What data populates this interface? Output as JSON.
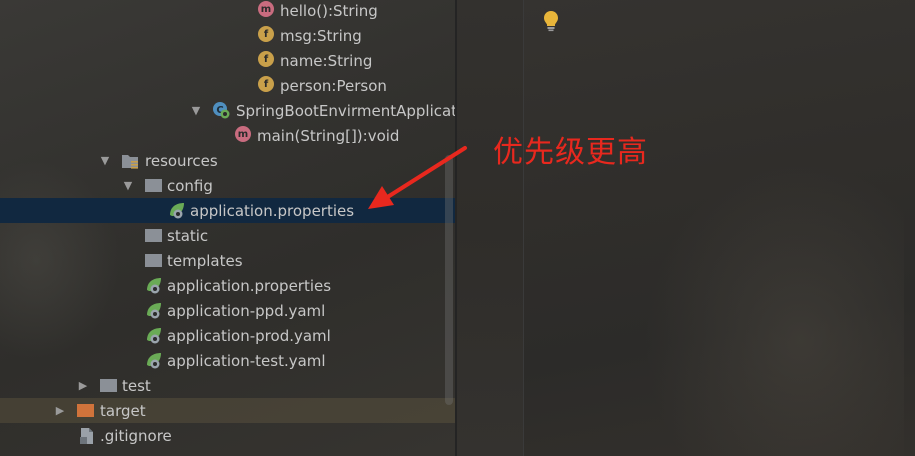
{
  "tree": {
    "items": [
      {
        "label": "hello():String",
        "icon": "method-icon",
        "icon_letter": "m"
      },
      {
        "label": "msg:String",
        "icon": "field-icon",
        "icon_letter": "f"
      },
      {
        "label": "name:String",
        "icon": "field-icon",
        "icon_letter": "f"
      },
      {
        "label": "person:Person",
        "icon": "field-icon",
        "icon_letter": "f"
      },
      {
        "label": "SpringBootEnvirmentApplicati",
        "icon": "spring-class-icon",
        "expanded": true
      },
      {
        "label": "main(String[]):void",
        "icon": "method-icon",
        "icon_letter": "m"
      },
      {
        "label": "resources",
        "icon": "resources-folder-icon",
        "expanded": true
      },
      {
        "label": "config",
        "icon": "folder-icon",
        "expanded": true
      },
      {
        "label": "application.properties",
        "icon": "spring-properties-icon",
        "selected": true
      },
      {
        "label": "static",
        "icon": "folder-icon"
      },
      {
        "label": "templates",
        "icon": "folder-icon"
      },
      {
        "label": "application.properties",
        "icon": "spring-properties-icon"
      },
      {
        "label": "application-ppd.yaml",
        "icon": "spring-yaml-icon"
      },
      {
        "label": "application-prod.yaml",
        "icon": "spring-yaml-icon"
      },
      {
        "label": "application-test.yaml",
        "icon": "spring-yaml-icon"
      },
      {
        "label": "test",
        "icon": "folder-icon",
        "expanded": false
      },
      {
        "label": "target",
        "icon": "excluded-folder-icon",
        "expanded": false
      },
      {
        "label": ".gitignore",
        "icon": "gitignore-icon"
      }
    ]
  },
  "annotation": {
    "text": "优先级更高",
    "color": "#e8281e"
  },
  "colors": {
    "selection": "#112840",
    "method": "#c96c7f",
    "field": "#c9a04a",
    "spring": "#6aab56",
    "folder": "#8b9097",
    "target_folder": "#d0733b",
    "bulb": "#e8b53a"
  }
}
